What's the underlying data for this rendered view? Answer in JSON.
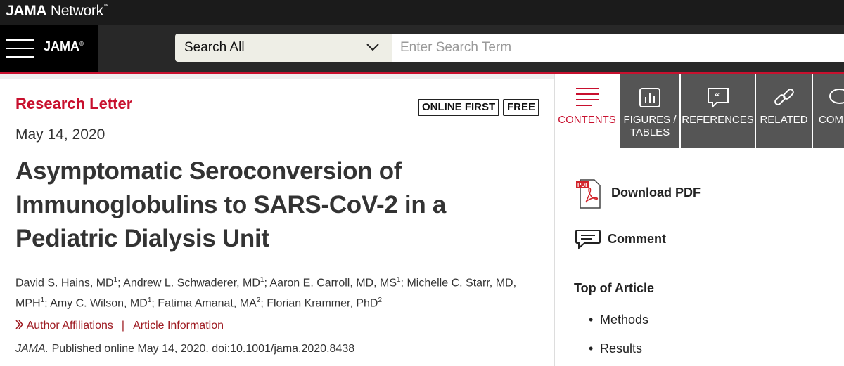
{
  "header": {
    "network_logo_bold": "JAMA",
    "network_logo_rest": " Network",
    "brand": "JAMA",
    "search": {
      "selected": "Search All",
      "placeholder": "Enter Search Term"
    }
  },
  "article": {
    "type": "Research Letter",
    "badges": [
      "ONLINE FIRST",
      "FREE"
    ],
    "date": "May 14, 2020",
    "title": "Asymptomatic Seroconversion of Immunoglobulins to SARS-CoV-2 in a Pediatric Dialysis Unit",
    "authors": [
      {
        "name": "David S. Hains, MD",
        "aff": "1"
      },
      {
        "name": "Andrew L. Schwaderer, MD",
        "aff": "1"
      },
      {
        "name": "Aaron E. Carroll, MD, MS",
        "aff": "1"
      },
      {
        "name": "Michelle C. Starr, MD, MPH",
        "aff": "1"
      },
      {
        "name": "Amy C. Wilson, MD",
        "aff": "1"
      },
      {
        "name": "Fatima Amanat, MA",
        "aff": "2"
      },
      {
        "name": "Florian Krammer, PhD",
        "aff": "2"
      }
    ],
    "links": {
      "affiliations": "Author Affiliations",
      "info": "Article Information",
      "separator": "|"
    },
    "citation": {
      "journal": "JAMA.",
      "text": " Published online May 14, 2020. doi:10.1001/jama.2020.8438"
    }
  },
  "sidebar": {
    "tabs": [
      {
        "label": "CONTENTS",
        "icon": "list-icon"
      },
      {
        "label": "FIGURES / TABLES",
        "icon": "bar-chart-icon"
      },
      {
        "label": "REFERENCES",
        "icon": "quote-icon"
      },
      {
        "label": "RELATED",
        "icon": "link-icon"
      },
      {
        "label": "COMM",
        "icon": "comment-icon"
      }
    ],
    "download_pdf": "Download PDF",
    "comment": "Comment",
    "toc_title": "Top of Article",
    "toc": [
      "Methods",
      "Results"
    ]
  }
}
